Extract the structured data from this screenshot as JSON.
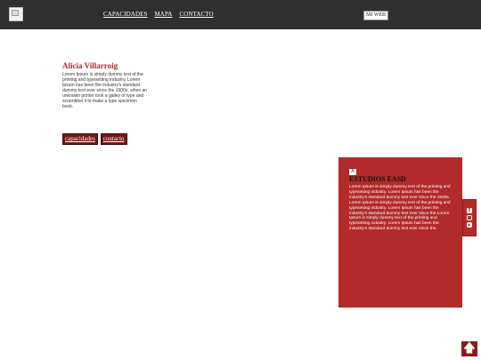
{
  "header": {
    "logo_icon": "broken-image-icon",
    "nav": [
      "CAPACIDADES",
      "MAPA",
      "CONTACTO"
    ],
    "cta_label": "MI WEB"
  },
  "profile": {
    "name": "Alicia Villarroig",
    "bio": "Lorem Ipsum is simply dummy text of the printing and typesetting industry. Lorem Ipsum has been the industry's standard dummy text ever since the 1500s, when an unknown printer took a galley of type and scrambled it to make a type specimen book."
  },
  "tags": [
    "capacidades",
    "contacto"
  ],
  "panel": {
    "close_label": "X",
    "title": "ESTUDIOS EASD",
    "body": "Lorem Ipsum is simply dummy text of the printing and typesetting industry. Lorem Ipsum has been the industry's standard dummy text ever since the 1500s. Lorem Ipsum is simply dummy text of the printing and typesetting industry. Lorem Ipsum has been the industry's standard dummy text ever since the Lorem Ipsum is simply dummy text of the printing and typesetting industry. Lorem Ipsum has been the industry's standard dummy text ever since the.",
    "color": "#b22a2a"
  },
  "social": {
    "icons": [
      "facebook-icon",
      "instagram-icon",
      "youtube-icon"
    ],
    "fb_glyph": "f",
    "ig_glyph": "",
    "yt_glyph": "▶"
  },
  "to_top": {
    "icon": "arrow-up-icon",
    "glyph": "🡅"
  },
  "colors": {
    "header_bg": "#2f2f2f",
    "accent": "#b22a2a",
    "tag_bg": "#7a1414"
  }
}
